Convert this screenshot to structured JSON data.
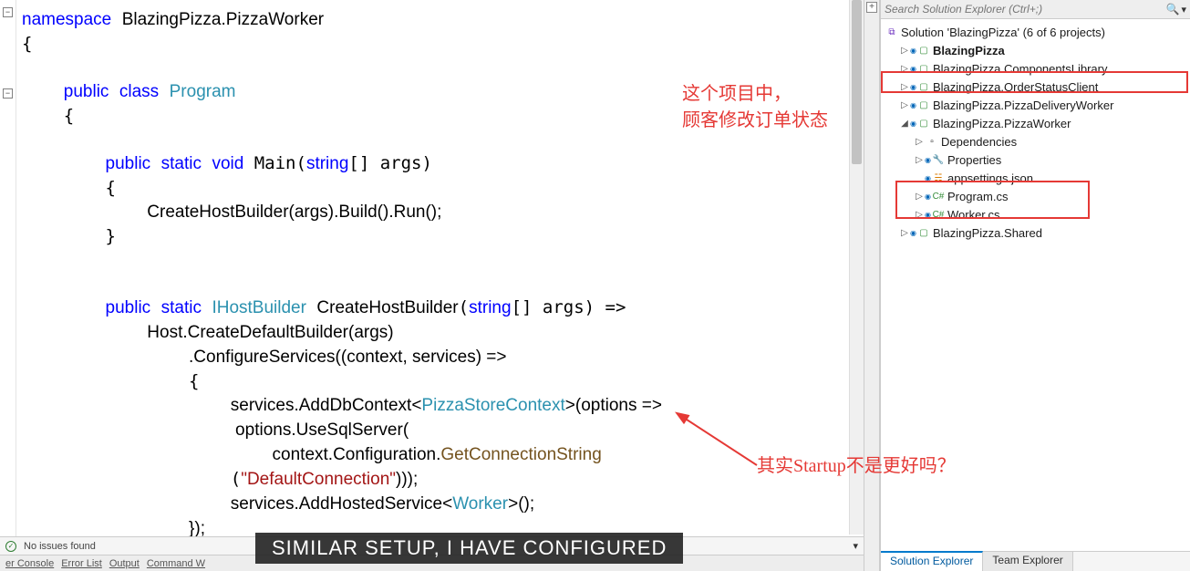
{
  "editor": {
    "namespace": "BlazingPizza.PizzaWorker",
    "class_name": "Program",
    "main_signature_args": "string[] args",
    "create_host_line": "CreateHostBuilder(args).Build().Run();",
    "ihostbuilder": "IHostBuilder",
    "createhost": "CreateHostBuilder",
    "createhost_args": "string[] args",
    "host_create": "Host.CreateDefaultBuilder(args)",
    "configure_services": ".ConfigureServices((context, services) =>",
    "add_db": "services.AddDbContext<",
    "pizza_ctx": "PizzaStoreContext",
    "options_lambda": ">(options =>",
    "use_sql": " options.UseSqlServer(",
    "get_conn_prefix": "context.Configuration.",
    "get_conn": "GetConnectionString",
    "conn_str": "\"DefaultConnection\"",
    "conn_close": ")));",
    "add_hosted": "services.AddHostedService<",
    "worker": "Worker",
    "add_hosted_close": ">();",
    "close_lambda": "});"
  },
  "status": {
    "issues": "No issues found"
  },
  "output_tabs": [
    "er Console",
    "Error List",
    "Output",
    "Command W"
  ],
  "annotations": {
    "top1": "这个项目中，",
    "top2": "顾客修改订单状态",
    "bottom": "其实Startup不是更好吗？"
  },
  "caption": "SIMILAR SETUP, I HAVE CONFIGURED",
  "solution_explorer": {
    "search_placeholder": "Search Solution Explorer (Ctrl+;)",
    "root": "Solution 'BlazingPizza' (6 of 6 projects)",
    "nodes": [
      {
        "indent": 1,
        "exp": "▷",
        "icon": "cs",
        "lock": true,
        "label": "BlazingPizza",
        "bold": true
      },
      {
        "indent": 1,
        "exp": "▷",
        "icon": "cs",
        "lock": true,
        "label": "BlazingPizza.ComponentsLibrary"
      },
      {
        "indent": 1,
        "exp": "▷",
        "icon": "cs",
        "lock": true,
        "label": "BlazingPizza.OrderStatusClient"
      },
      {
        "indent": 1,
        "exp": "▷",
        "icon": "cs",
        "lock": true,
        "label": "BlazingPizza.PizzaDeliveryWorker"
      },
      {
        "indent": 1,
        "exp": "◢",
        "icon": "cs",
        "lock": true,
        "label": "BlazingPizza.PizzaWorker"
      },
      {
        "indent": 2,
        "exp": "▷",
        "icon": "dep",
        "label": "Dependencies"
      },
      {
        "indent": 2,
        "exp": "▷",
        "icon": "wrench",
        "lock": true,
        "label": "Properties"
      },
      {
        "indent": 2,
        "exp": "",
        "icon": "json",
        "lock": true,
        "label": "appsettings.json"
      },
      {
        "indent": 2,
        "exp": "▷",
        "icon": "csfile",
        "lock": true,
        "label": "Program.cs"
      },
      {
        "indent": 2,
        "exp": "▷",
        "icon": "csfile",
        "lock": true,
        "label": "Worker.cs"
      },
      {
        "indent": 1,
        "exp": "▷",
        "icon": "cs",
        "lock": true,
        "label": "BlazingPizza.Shared"
      }
    ],
    "tabs": {
      "active": "Solution Explorer",
      "other": "Team Explorer"
    }
  }
}
